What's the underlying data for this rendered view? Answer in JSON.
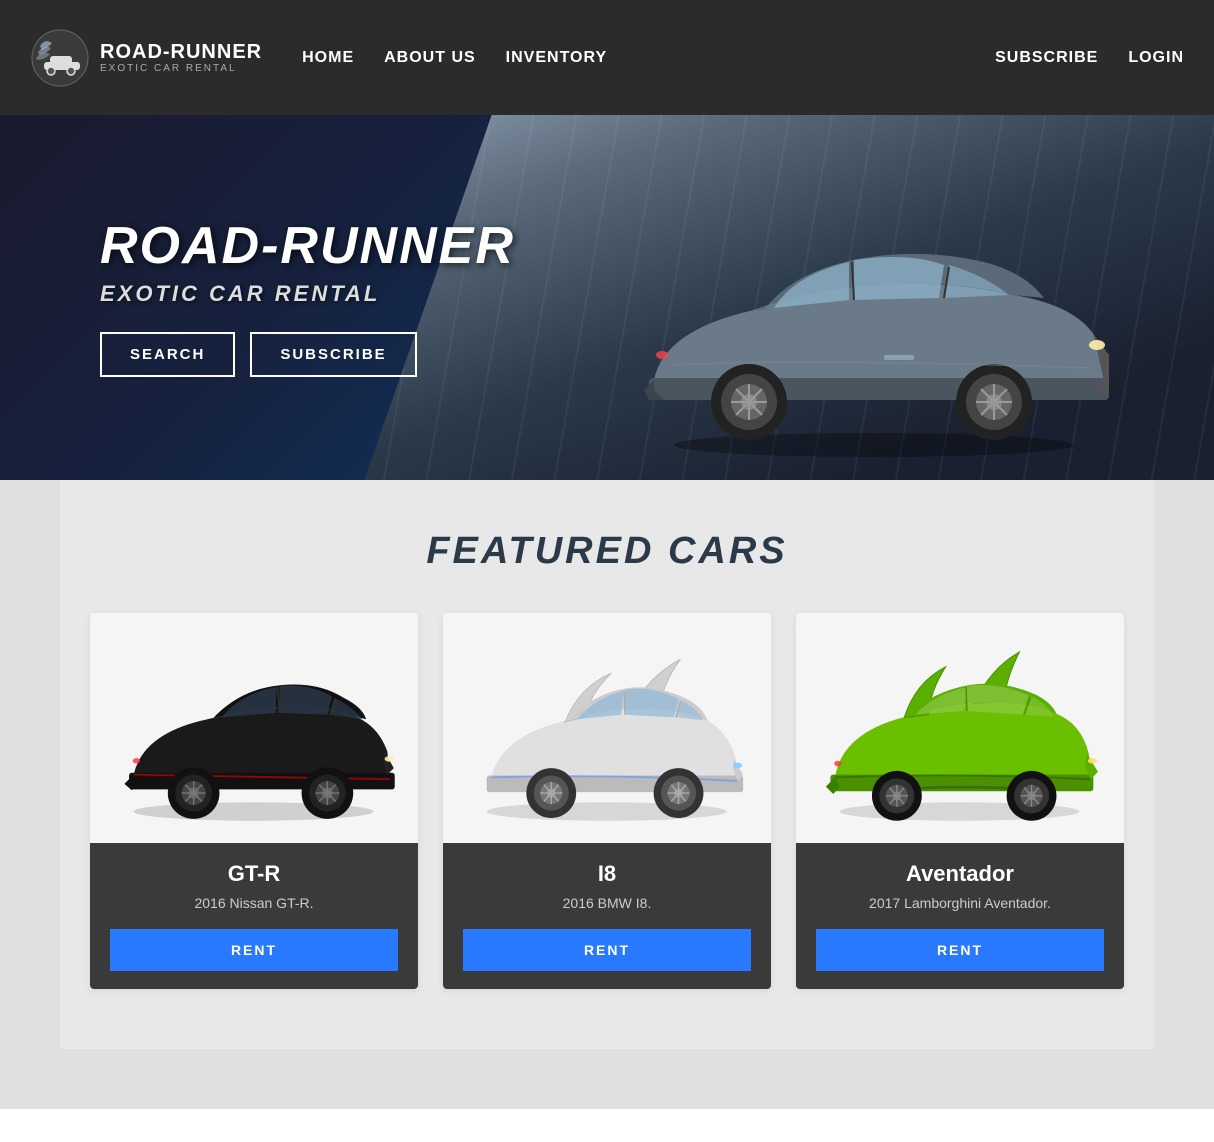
{
  "navbar": {
    "logo_main": "ROAD-RUNNER",
    "logo_sub": "EXOTIC CAR RENTAL",
    "nav_links": [
      {
        "label": "HOME",
        "id": "home"
      },
      {
        "label": "ABOUT US",
        "id": "about"
      },
      {
        "label": "INVENTORY",
        "id": "inventory"
      }
    ],
    "nav_right": [
      {
        "label": "SUBSCRIBE",
        "id": "subscribe"
      },
      {
        "label": "LOGIN",
        "id": "login"
      }
    ]
  },
  "hero": {
    "title": "ROAD-RUNNER",
    "subtitle": "EXOTIC CAR RENTAL",
    "search_btn": "SEARCH",
    "subscribe_btn": "SUBSCRIBE"
  },
  "featured": {
    "section_title": "FEATURED CARS",
    "cars": [
      {
        "name": "GT-R",
        "description": "2016 Nissan GT-R.",
        "rent_label": "RENT",
        "color": "#111"
      },
      {
        "name": "I8",
        "description": "2016 BMW I8.",
        "rent_label": "RENT",
        "color": "#e8e8e8"
      },
      {
        "name": "Aventador",
        "description": "2017 Lamborghini Aventador.",
        "rent_label": "RENT",
        "color": "#6abf00"
      }
    ]
  }
}
